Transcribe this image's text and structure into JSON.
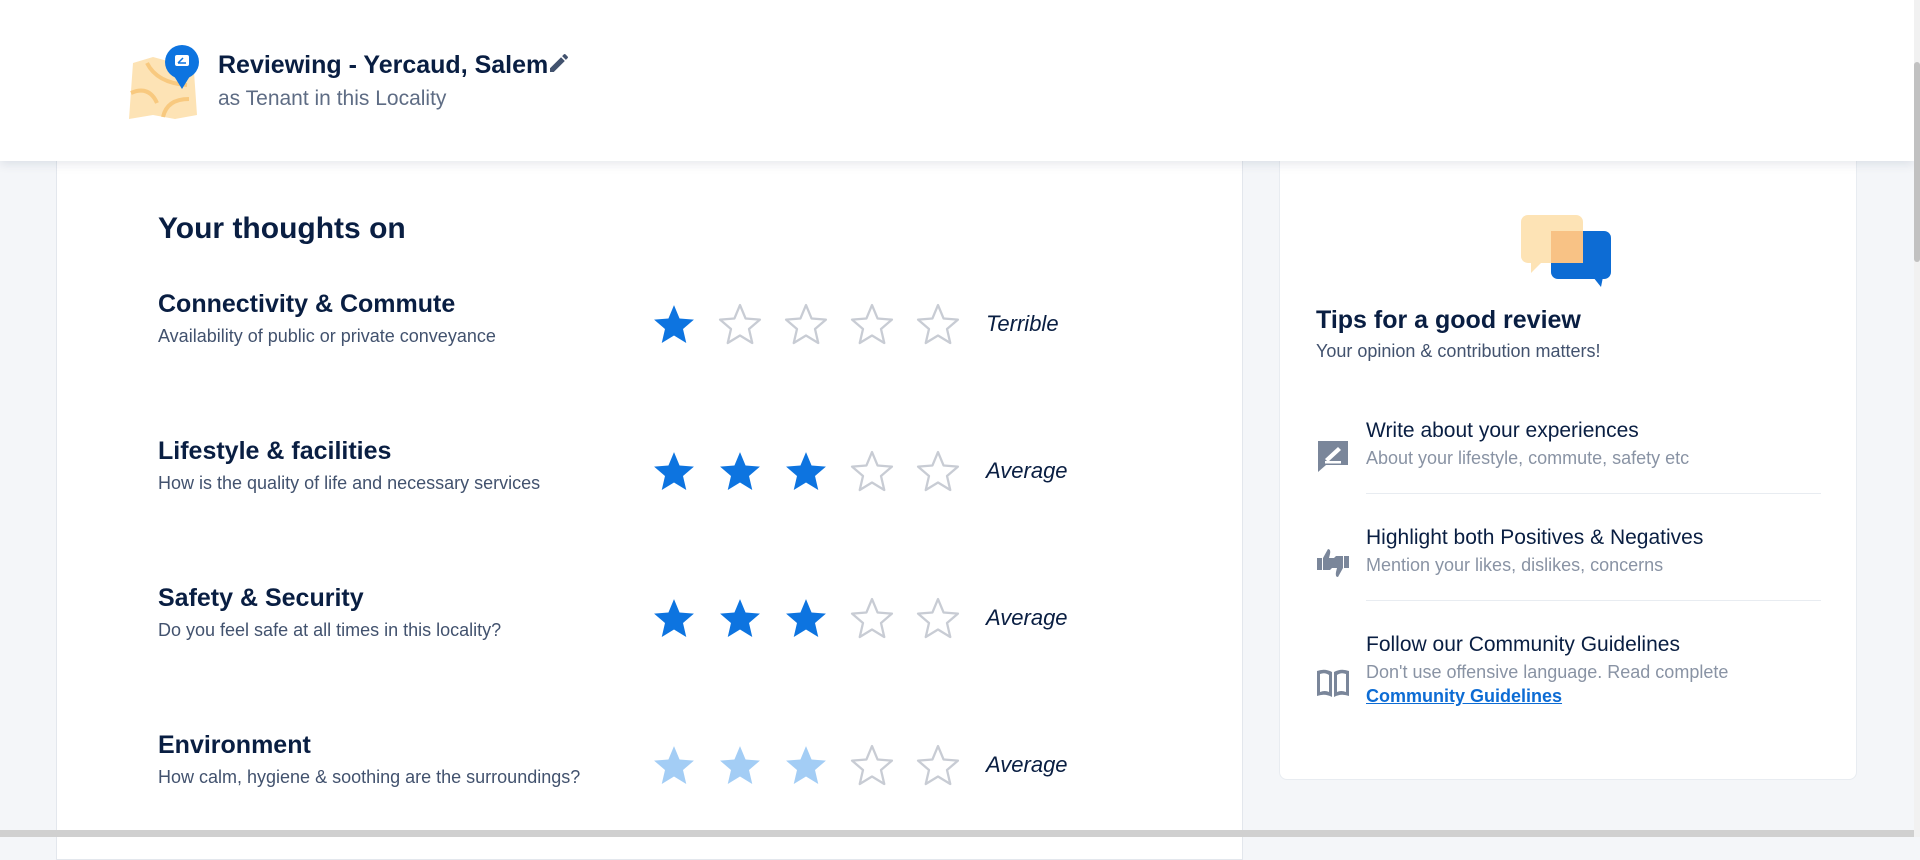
{
  "header": {
    "title": "Reviewing - Yercaud, Salem",
    "subtitle": "as Tenant in this Locality",
    "illustration_icon": "map-pin-illustration",
    "edit_icon": "pencil-icon"
  },
  "form": {
    "heading": "Your thoughts on",
    "ratings": [
      {
        "title": "Connectivity & Commute",
        "description": "Availability of public or private conveyance",
        "rating": 1,
        "max": 5,
        "label": "Terrible",
        "state": "rated"
      },
      {
        "title": "Lifestyle & facilities",
        "description": "How is the quality of life and necessary services",
        "rating": 3,
        "max": 5,
        "label": "Average",
        "state": "rated"
      },
      {
        "title": "Safety & Security",
        "description": "Do you feel safe at all times in this locality?",
        "rating": 3,
        "max": 5,
        "label": "Average",
        "state": "rated"
      },
      {
        "title": "Environment",
        "description": "How calm, hygiene & soothing are the surroundings?",
        "rating": 3,
        "max": 5,
        "label": "Average",
        "state": "pending"
      }
    ]
  },
  "tips": {
    "title": "Tips for a good review",
    "subtitle": "Your opinion & contribution matters!",
    "illustration_icon": "chat-bubbles-illustration",
    "items": [
      {
        "icon": "write-review-icon",
        "title": "Write about your experiences",
        "description": "About your lifestyle, commute, safety etc"
      },
      {
        "icon": "thumbs-up-down-icon",
        "title": "Highlight both Positives & Negatives",
        "description": "Mention your likes, dislikes, concerns"
      },
      {
        "icon": "book-icon",
        "title": "Follow our Community Guidelines",
        "description": "Don't use offensive language. Read complete",
        "link": "Community Guidelines"
      }
    ]
  },
  "colors": {
    "star_filled": "#0d74e0",
    "star_pending": "#a3cdf5",
    "star_empty_stroke": "#c8ccd4",
    "link": "#0d6cd4",
    "primary_text": "#091e42"
  }
}
